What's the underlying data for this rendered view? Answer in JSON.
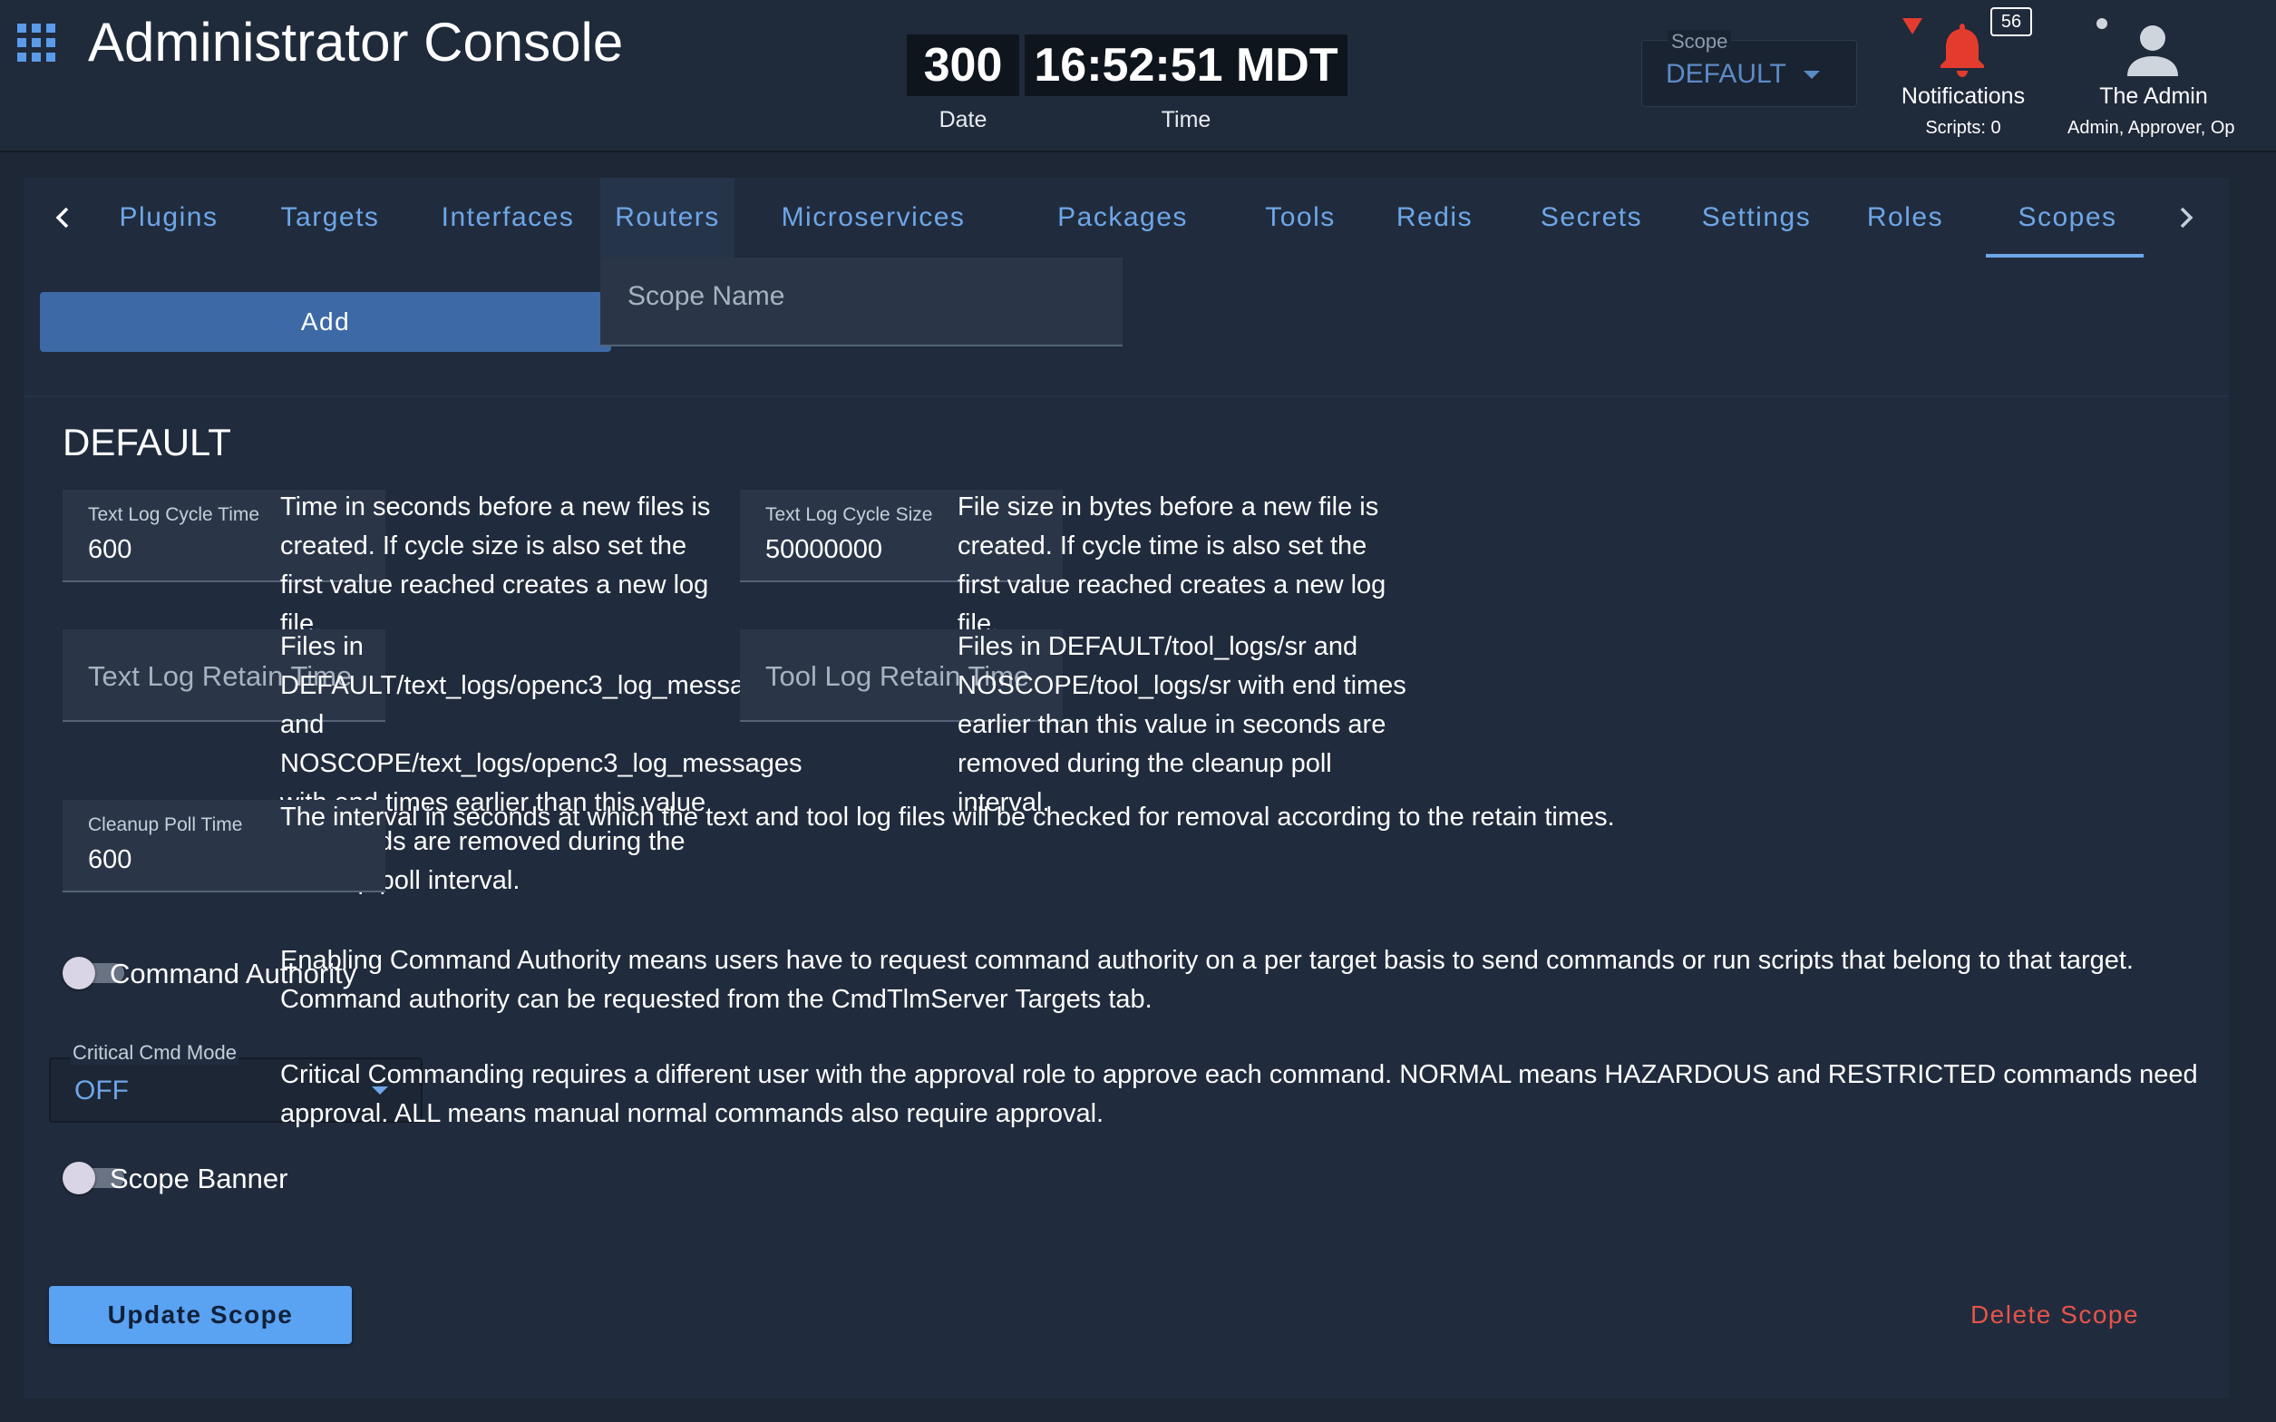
{
  "header": {
    "title": "Administrator Console",
    "date_value": "300",
    "date_label": "Date",
    "time_value": "16:52:51 MDT",
    "time_label": "Time",
    "scope": {
      "label": "Scope",
      "value": "DEFAULT"
    },
    "notifications": {
      "count": "56",
      "label": "Notifications",
      "scripts": "Scripts: 0"
    },
    "user": {
      "name": "The Admin",
      "roles": "Admin, Approver, Op"
    }
  },
  "tabs": [
    {
      "label": "Plugins"
    },
    {
      "label": "Targets"
    },
    {
      "label": "Interfaces"
    },
    {
      "label": "Routers"
    },
    {
      "label": "Microservices"
    },
    {
      "label": "Packages"
    },
    {
      "label": "Tools"
    },
    {
      "label": "Redis"
    },
    {
      "label": "Secrets"
    },
    {
      "label": "Settings"
    },
    {
      "label": "Roles"
    },
    {
      "label": "Scopes",
      "active": true
    }
  ],
  "add_form": {
    "add_label": "Add",
    "scope_name_placeholder": "Scope Name"
  },
  "scope": {
    "name": "DEFAULT",
    "text_log_cycle_time": {
      "label": "Text Log Cycle Time",
      "value": "600",
      "description": "Time in seconds before a new files is created. If cycle size is also set the first value reached creates a new log file."
    },
    "text_log_cycle_size": {
      "label": "Text Log Cycle Size",
      "value": "50000000",
      "description": "File size in bytes before a new file is created. If cycle time is also set the first value reached creates a new log file."
    },
    "text_log_retain_time": {
      "placeholder": "Text Log Retain Time",
      "description": "Files in DEFAULT/text_logs/openc3_log_messages and NOSCOPE/text_logs/openc3_log_messages with end times earlier than this value in seconds are removed during the cleanup poll interval."
    },
    "tool_log_retain_time": {
      "placeholder": "Tool Log Retain Time",
      "description": "Files in DEFAULT/tool_logs/sr and NOSCOPE/tool_logs/sr with end times earlier than this value in seconds are removed during the cleanup poll interval."
    },
    "cleanup_poll_time": {
      "label": "Cleanup Poll Time",
      "value": "600",
      "description": "The interval in seconds at which the text and tool log files will be checked for removal according to the retain times."
    },
    "command_authority": {
      "label": "Command Authority",
      "enabled": false,
      "description": "Enabling Command Authority means users have to request command authority on a per target basis to send commands or run scripts that belong to that target. Command authority can be requested from the CmdTlmServer Targets tab."
    },
    "critical_cmd_mode": {
      "label": "Critical Cmd Mode",
      "value": "OFF",
      "description": "Critical Commanding requires a different user with the approval role to approve each command. NORMAL means HAZARDOUS and RESTRICTED commands need approval. ALL means manual normal commands also require approval."
    },
    "scope_banner": {
      "label": "Scope Banner",
      "enabled": false
    }
  },
  "actions": {
    "update_label": "Update Scope",
    "delete_label": "Delete Scope"
  },
  "colors": {
    "accent": "#6ea6e8",
    "primary_button": "#5aa2f2",
    "danger": "#e5544a",
    "notification": "#e33c2e"
  }
}
